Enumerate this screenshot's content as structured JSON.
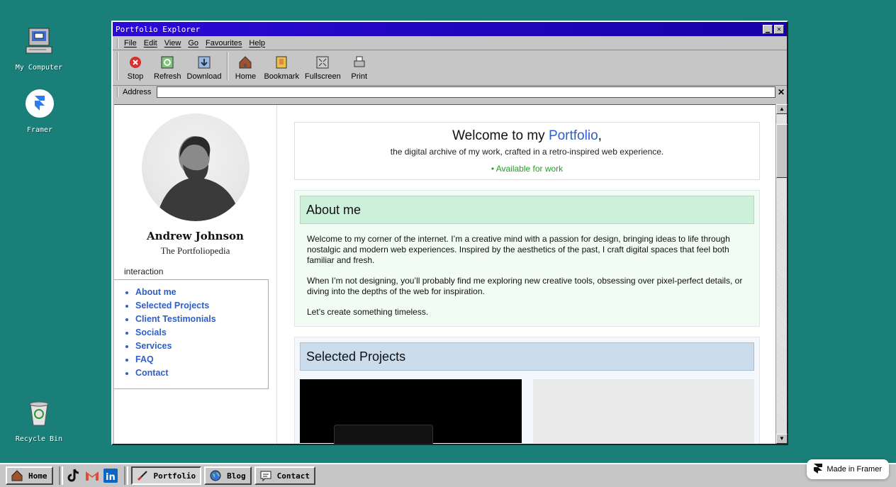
{
  "desktop": {
    "icons": [
      {
        "label": "My Computer"
      },
      {
        "label": "Framer"
      },
      {
        "label": "Recycle Bin"
      }
    ]
  },
  "window": {
    "title": "Portfolio Explorer",
    "menu": [
      "File",
      "Edit",
      "View",
      "Go",
      "Favourites",
      "Help"
    ],
    "toolbar": {
      "stop": "Stop",
      "refresh": "Refresh",
      "download": "Download",
      "home": "Home",
      "bookmark": "Bookmark",
      "fullscreen": "Fullscreen",
      "print": "Print"
    },
    "address": {
      "label": "Address",
      "value": ""
    }
  },
  "sidebar": {
    "name": "Andrew Johnson",
    "subtitle": "The Portfoliopedia",
    "nav_label": "interaction",
    "nav": [
      "About me",
      "Selected Projects",
      "Client Testimonials",
      "Socials",
      "Services",
      "FAQ",
      "Contact"
    ]
  },
  "main": {
    "welcome_prefix": "Welcome to my ",
    "welcome_accent": "Portfolio",
    "welcome_suffix": ",",
    "tagline": "the digital archive of my work, crafted in a retro-inspired web experience.",
    "availability": "Available for work",
    "about": {
      "heading": "About me",
      "p1": "Welcome to my corner of the internet. I’m a creative mind with a passion for design, bringing ideas to life through nostalgic and modern web experiences. Inspired by the aesthetics of the past, I craft digital spaces that feel both familiar and fresh.",
      "p2": "When I’m not designing, you’ll probably find me exploring new creative tools, obsessing over pixel-perfect details, or diving into the depths of the web for inspiration.",
      "p3": "Let’s create something timeless."
    },
    "projects": {
      "heading": "Selected Projects"
    }
  },
  "taskbar": {
    "home": "Home",
    "portfolio": "Portfolio",
    "blog": "Blog",
    "contact": "Contact"
  },
  "badge": "Made in Framer",
  "colors": {
    "accent": "#2d5ec9",
    "available": "#2a9a2a",
    "desktop": "#1a7f79",
    "titlebar": "#2b0ad6"
  }
}
